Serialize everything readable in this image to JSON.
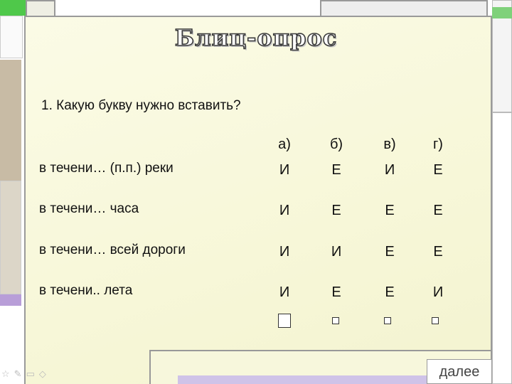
{
  "slide": {
    "title": "Блиц-опрос",
    "question": "1. Какую букву нужно вставить?",
    "options": [
      "а)",
      "б)",
      "в)",
      "г)"
    ],
    "rows": [
      {
        "label": "в течени… (п.п.) реки",
        "answers": [
          "И",
          "Е",
          "И",
          "Е"
        ]
      },
      {
        "label": "в течени… часа",
        "answers": [
          "И",
          "Е",
          "Е",
          "Е"
        ]
      },
      {
        "label": "в течени… всей дороги",
        "answers": [
          "И",
          "И",
          "Е",
          "Е"
        ]
      },
      {
        "label": "в течени.. лета",
        "answers": [
          "И",
          "Е",
          "Е",
          "И"
        ]
      }
    ],
    "next_label": "далее",
    "nav_icons": [
      "star-icon",
      "pencil-icon",
      "square-icon",
      "diamond-icon"
    ]
  }
}
